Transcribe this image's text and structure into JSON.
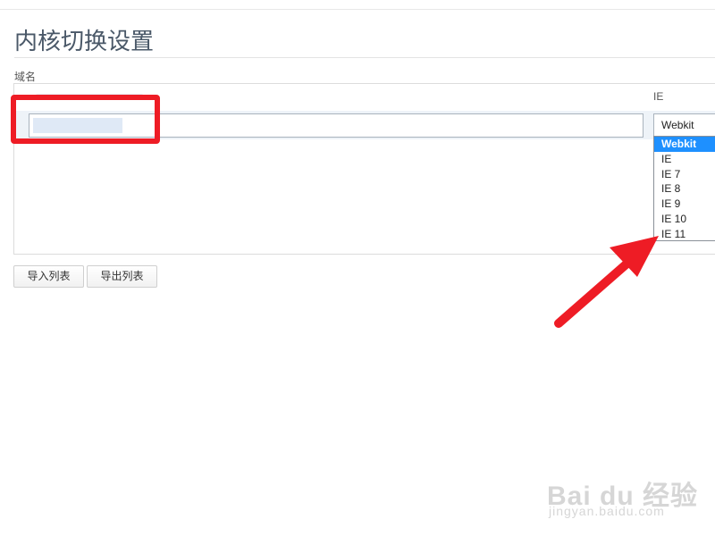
{
  "page": {
    "title": "内核切换设置",
    "domain_label": "域名",
    "ie_column_label": "IE"
  },
  "domain_row": {
    "value": ""
  },
  "kernel_select": {
    "selected": "Webkit",
    "options": [
      "Webkit",
      "IE",
      "IE 7",
      "IE 8",
      "IE 9",
      "IE 10",
      "IE 11"
    ]
  },
  "buttons": {
    "import_label": "导入列表",
    "export_label": "导出列表"
  },
  "annotations": {
    "highlight_color": "#ee1c25",
    "arrow_color": "#ee1c25",
    "arrow_points_to": "IE 11"
  },
  "watermark": {
    "main": "Bai du 经验",
    "sub": "jingyan.baidu.com"
  },
  "colors": {
    "selected_option_bg": "#1e90ff",
    "title_color": "#4a5868"
  }
}
